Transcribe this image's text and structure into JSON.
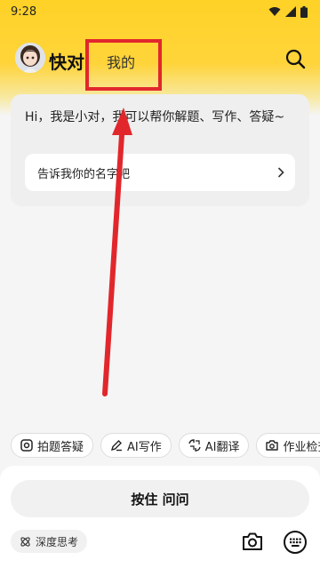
{
  "status_bar": {
    "time": "9:28"
  },
  "header": {
    "app_title": "快对",
    "tab_mine": "我的",
    "avatar_icon": "avatar-girl",
    "search_icon": "search-icon"
  },
  "chat": {
    "greeting": "Hi，我是小对，我可以帮你解题、写作、答疑~",
    "name_prompt": "告诉我你的名字吧"
  },
  "chips": [
    {
      "label": "拍题答疑",
      "icon": "scan-icon"
    },
    {
      "label": "AI写作",
      "icon": "pen-icon"
    },
    {
      "label": "AI翻译",
      "icon": "translate-icon"
    },
    {
      "label": "作业检查",
      "icon": "camera-icon"
    }
  ],
  "bottom": {
    "hold_label": "按住 问问",
    "deep_think": "深度思考"
  },
  "colors": {
    "brand_yellow": "#ffd227",
    "highlight_red": "#e1272c"
  }
}
